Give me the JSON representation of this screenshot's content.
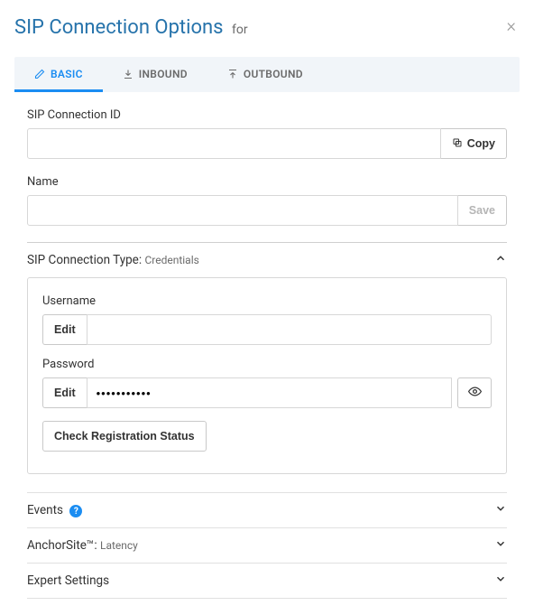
{
  "header": {
    "title": "SIP Connection Options",
    "for_label": "for"
  },
  "tabs": [
    {
      "id": "basic",
      "label": "BASIC",
      "active": true
    },
    {
      "id": "inbound",
      "label": "INBOUND",
      "active": false
    },
    {
      "id": "outbound",
      "label": "OUTBOUND",
      "active": false
    }
  ],
  "fields": {
    "sip_id_label": "SIP Connection ID",
    "sip_id_value": "",
    "copy_label": "Copy",
    "name_label": "Name",
    "name_value": "",
    "save_label": "Save"
  },
  "credentials": {
    "section_label": "SIP Connection Type:",
    "section_sub": "Credentials",
    "username_label": "Username",
    "username_value": "",
    "password_label": "Password",
    "password_value": "•••••••••••",
    "edit_label": "Edit",
    "check_label": "Check Registration Status"
  },
  "sections": {
    "events_label": "Events",
    "anchorsite_label": "AnchorSite™:",
    "anchorsite_sub": "Latency",
    "expert_label": "Expert Settings"
  }
}
